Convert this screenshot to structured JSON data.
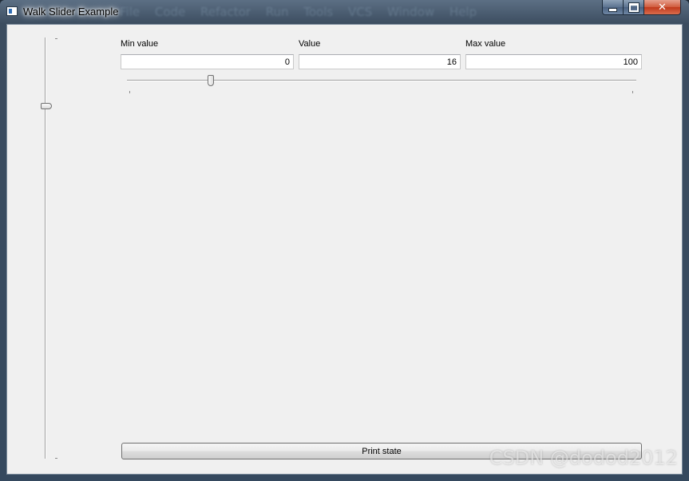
{
  "window": {
    "title": "Walk Slider Example",
    "background_menu": "File  Code  Refactor  Run  Tools  VCS  Window  Help"
  },
  "caption_buttons": {
    "close_glyph": "✕"
  },
  "fields": {
    "min": {
      "label": "Min value",
      "value": "0"
    },
    "value": {
      "label": "Value",
      "value": "16"
    },
    "max": {
      "label": "Max value",
      "value": "100"
    }
  },
  "sliders": {
    "min": 0,
    "max": 100,
    "value": 16
  },
  "print_button": {
    "label": "Print state"
  },
  "watermark": "CSDN @dodod2012",
  "colors": {
    "client_bg": "#f0f0f0",
    "close_button": "#c0391b"
  }
}
